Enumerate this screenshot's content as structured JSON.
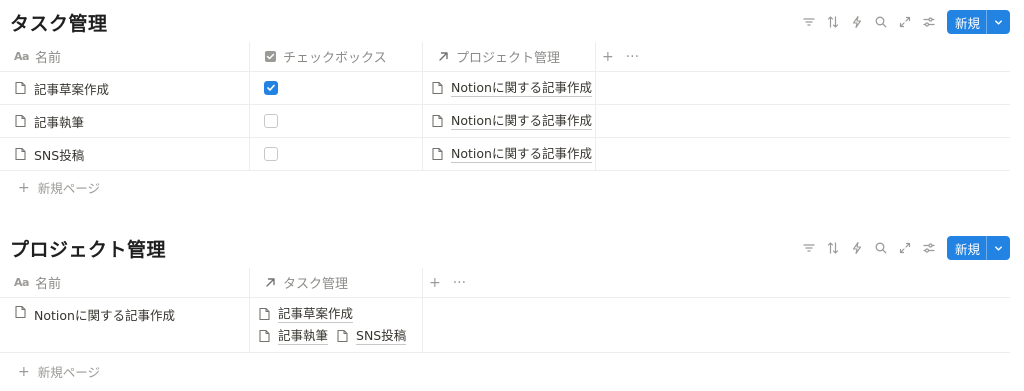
{
  "colors": {
    "accent": "#2383e2",
    "muted": "#9b9a97",
    "text": "#37352f"
  },
  "db1": {
    "title": "タスク管理",
    "toolbar": {
      "icons": [
        "filter-icon",
        "sort-icon",
        "automation-icon",
        "search-icon",
        "expand-icon",
        "settings-icon"
      ],
      "new_label": "新規"
    },
    "columns": [
      {
        "icon": "Aa",
        "label": "名前"
      },
      {
        "icon": "checkbox-icon",
        "label": "チェックボックス"
      },
      {
        "icon": "relation-arrow-icon",
        "label": "プロジェクト管理"
      }
    ],
    "rows": [
      {
        "name": "記事草案作成",
        "checked": true,
        "relation": "Notionに関する記事作成"
      },
      {
        "name": "記事執筆",
        "checked": false,
        "relation": "Notionに関する記事作成"
      },
      {
        "name": "SNS投稿",
        "checked": false,
        "relation": "Notionに関する記事作成"
      }
    ],
    "new_page_label": "新規ページ"
  },
  "db2": {
    "title": "プロジェクト管理",
    "toolbar": {
      "icons": [
        "filter-icon",
        "sort-icon",
        "automation-icon",
        "search-icon",
        "expand-icon",
        "settings-icon"
      ],
      "new_label": "新規"
    },
    "columns": [
      {
        "icon": "Aa",
        "label": "名前"
      },
      {
        "icon": "relation-arrow-icon",
        "label": "タスク管理"
      }
    ],
    "rows": [
      {
        "name": "Notionに関する記事作成",
        "relations": [
          "記事草案作成",
          "記事執筆",
          "SNS投稿"
        ]
      }
    ],
    "new_page_label": "新規ページ"
  }
}
